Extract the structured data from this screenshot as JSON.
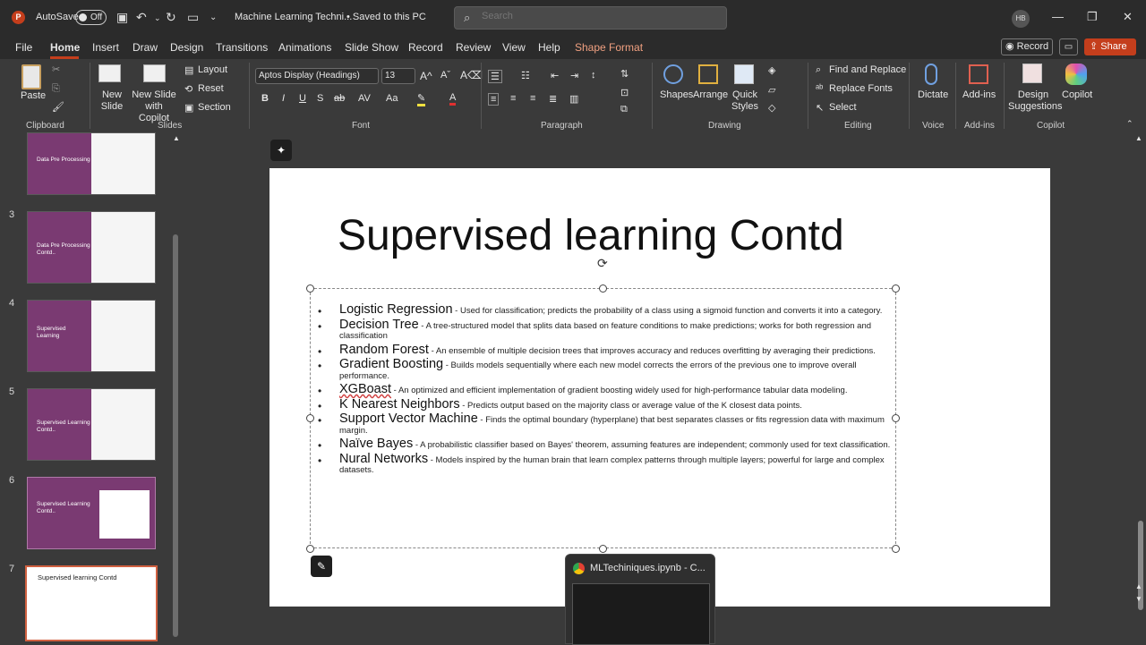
{
  "titlebar": {
    "app_icon": "P",
    "autosave_label": "AutoSave",
    "autosave_state": "Off",
    "doc_title": "Machine Learning Techni...",
    "saved_status": "• Saved to this PC",
    "search_placeholder": "Search",
    "user_initials": "HB"
  },
  "menus": [
    "File",
    "Home",
    "Insert",
    "Draw",
    "Design",
    "Transitions",
    "Animations",
    "Slide Show",
    "Record",
    "Review",
    "View",
    "Help",
    "Shape Format"
  ],
  "menu_actions": {
    "record": "Record",
    "share": "Share"
  },
  "ribbon": {
    "clipboard": {
      "paste": "Paste",
      "label": "Clipboard"
    },
    "slides": {
      "new_slide": "New Slide",
      "new_slide_copilot": "New Slide with Copilot",
      "layout": "Layout",
      "reset": "Reset",
      "section": "Section",
      "label": "Slides"
    },
    "font": {
      "family": "Aptos Display (Headings)",
      "size": "13",
      "label": "Font"
    },
    "paragraph": {
      "label": "Paragraph"
    },
    "drawing": {
      "shapes": "Shapes",
      "arrange": "Arrange",
      "quick_styles": "Quick Styles",
      "label": "Drawing"
    },
    "editing": {
      "find_replace": "Find and Replace",
      "replace_fonts": "Replace Fonts",
      "select": "Select",
      "label": "Editing"
    },
    "voice": {
      "dictate": "Dictate",
      "label": "Voice"
    },
    "addins": {
      "addins": "Add-ins",
      "label": "Add-ins"
    },
    "copilot": {
      "design_suggestions": "Design Suggestions",
      "copilot": "Copilot",
      "label": "Copilot"
    }
  },
  "thumbnails": [
    {
      "num": "",
      "title": "Data Pre Processing"
    },
    {
      "num": "3",
      "title": "Data Pre Processing Contd.."
    },
    {
      "num": "4",
      "title": "Supervised Learning"
    },
    {
      "num": "5",
      "title": "Supervised Learning Contd.."
    },
    {
      "num": "6",
      "title": "Supervised Learning Contd.."
    },
    {
      "num": "7",
      "title": "Supervised learning Contd"
    }
  ],
  "slide": {
    "title": "Supervised learning Contd",
    "items": [
      {
        "term": "Logistic Regression",
        "desc": " - Used for classification; predicts the probability of a class using a sigmoid function and converts it into a category."
      },
      {
        "term": "Decision Tree",
        "desc": " - A tree-structured model that splits data based on feature conditions to make predictions; works for both regression and classification"
      },
      {
        "term": "Random Forest",
        "desc": " - An ensemble of multiple decision trees that improves accuracy and reduces overfitting by averaging their predictions."
      },
      {
        "term": "Gradient Boosting",
        "desc": " - Builds models sequentially where each new model corrects the errors of the previous one to improve overall performance."
      },
      {
        "term": "XGBoast",
        "desc": " - An optimized and efficient implementation of gradient boosting widely used for high-performance tabular data modeling."
      },
      {
        "term": "K Nearest Neighbors",
        "desc": " - Predicts output based on the majority class or average value of the K closest data points."
      },
      {
        "term": "Support Vector Machine",
        "desc": " - Finds the optimal boundary (hyperplane) that best separates classes or fits regression data with maximum margin."
      },
      {
        "term": "Naïve Bayes",
        "desc": " - A probabilistic classifier based on Bayes' theorem, assuming features are independent; commonly used for text classification."
      },
      {
        "term": "Nural Networks",
        "desc": " - Models inspired by the human brain that learn complex patterns through multiple layers; powerful for large and complex datasets."
      }
    ]
  },
  "taskbar_popup": {
    "title": "MLTechiniques.ipynb - C..."
  }
}
